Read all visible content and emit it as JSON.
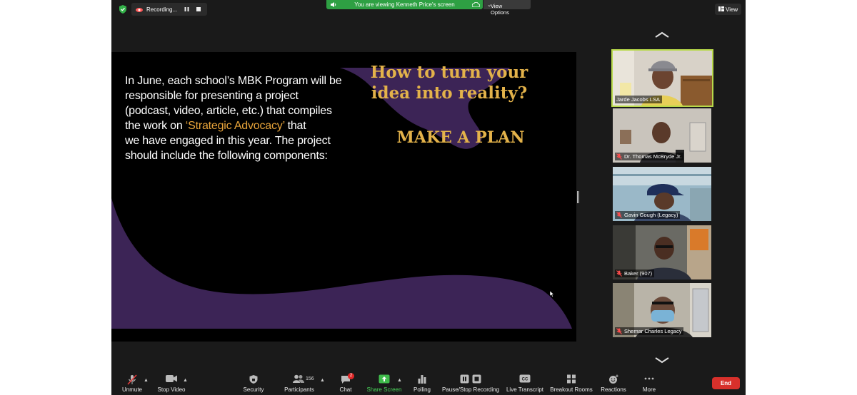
{
  "top_bar": {
    "recording_label": "Recording...",
    "viewing_banner": "You are viewing Kenneth Price's screen",
    "view_options_label": "View Options",
    "view_button_label": "View"
  },
  "slide": {
    "body_lines": [
      "In June, each school’s MBK Program will be",
      "responsible for presenting a project",
      "(podcast, video, article, etc.) that compiles",
      "the work on",
      "‘Strategic Advocacy’",
      "that",
      "we have engaged in this year. The project",
      "should include the following components:"
    ],
    "heading_lines": [
      "How to turn your",
      "idea into reality?"
    ],
    "cta": "MAKE A PLAN",
    "colors": {
      "accent": "#e3b24a",
      "highlight": "#e8a43a",
      "purple": "#3c2456"
    }
  },
  "participants": [
    {
      "name": "Jarde Jacobs LSA",
      "active_speaker": true,
      "muted": false
    },
    {
      "name": "Dr. Thomas McBryde Jr.",
      "muted": true
    },
    {
      "name": "Gavin Gough (Legacy)",
      "muted": true
    },
    {
      "name": "Baker (907)",
      "muted": true
    },
    {
      "name": "Shemar Charles Legacy",
      "muted": true
    }
  ],
  "toolbar": {
    "unmute": "Unmute",
    "stop_video": "Stop Video",
    "security": "Security",
    "participants": "Participants",
    "participants_count": "156",
    "chat": "Chat",
    "chat_badge": "2",
    "share_screen": "Share Screen",
    "polling": "Polling",
    "pause_stop_recording": "Pause/Stop Recording",
    "live_transcript": "Live Transcript",
    "breakout_rooms": "Breakout Rooms",
    "reactions": "Reactions",
    "more": "More",
    "end": "End"
  }
}
